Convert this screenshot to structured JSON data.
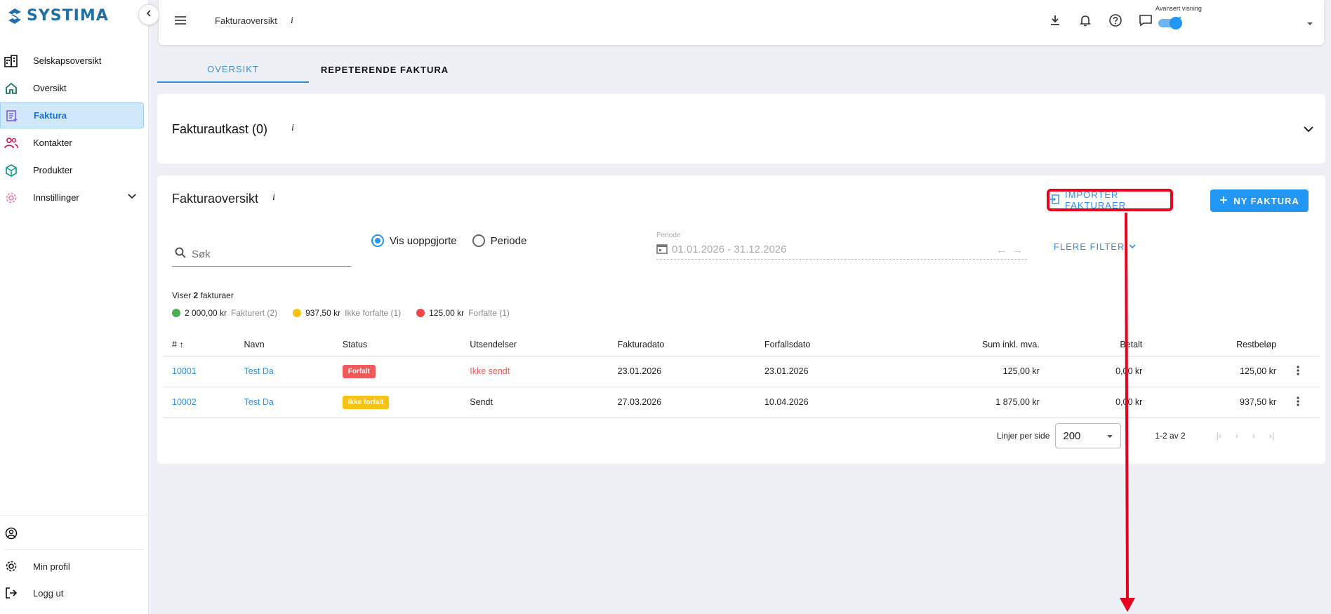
{
  "app": {
    "logo_text": "SYSTIMA"
  },
  "sidebar": {
    "items": [
      {
        "label": "Selskapsoversikt",
        "icon": "building-icon"
      },
      {
        "label": "Oversikt",
        "icon": "home-icon"
      },
      {
        "label": "Faktura",
        "icon": "invoice-icon",
        "active": true
      },
      {
        "label": "Kontakter",
        "icon": "people-icon"
      },
      {
        "label": "Produkter",
        "icon": "box-icon"
      },
      {
        "label": "Innstillinger",
        "icon": "gear-icon"
      }
    ],
    "bottom": [
      {
        "label": "",
        "icon": "user-circle-icon"
      },
      {
        "label": "Min profil",
        "icon": "gear-icon"
      },
      {
        "label": "Logg ut",
        "icon": "logout-icon"
      }
    ]
  },
  "header": {
    "title": "Fakturaoversikt",
    "info": "i",
    "advanced_label": "Avansert visning",
    "advanced_on": true
  },
  "tabs": [
    {
      "label": "OVERSIKT",
      "active": true
    },
    {
      "label": "REPETERENDE FAKTURA",
      "active": false
    }
  ],
  "drafts": {
    "title": "Fakturautkast (0)",
    "info": "i"
  },
  "overview": {
    "title": "Fakturaoversikt",
    "info": "i",
    "import_label": "IMPORTER FAKTURAER",
    "new_label": "NY FAKTURA",
    "search_placeholder": "Søk",
    "radio_unsettled": "Vis uoppgjorte",
    "radio_period": "Periode",
    "period_label": "Periode",
    "period_value": "01.01.2026 - 31.12.2026",
    "more_filters": "FLERE FILTER",
    "showing_prefix": "Viser",
    "showing_count": "2",
    "showing_suffix": "fakturaer",
    "legend": [
      {
        "amount": "2 000,00 kr",
        "label": "Fakturert (2)",
        "color": "#4caf50"
      },
      {
        "amount": "937,50 kr",
        "label": "Ikke forfalte (1)",
        "color": "#f7c214"
      },
      {
        "amount": "125,00 kr",
        "label": "Forfalte (1)",
        "color": "#f04848"
      }
    ],
    "columns": [
      "#",
      "Navn",
      "Status",
      "Utsendelser",
      "Fakturadato",
      "Forfallsdato",
      "Sum inkl. mva.",
      "Betalt",
      "Restbeløp"
    ],
    "rows": [
      {
        "id": "10001",
        "name": "Test Da",
        "status": "Forfalt",
        "sending": "Ikke sendt",
        "invoice_date": "23.01.2026",
        "due_date": "23.01.2026",
        "sum": "125,00 kr",
        "paid": "0,00 kr",
        "rest": "125,00 kr"
      },
      {
        "id": "10002",
        "name": "Test Da",
        "status": "Ikke forfalt",
        "sending": "Sendt",
        "invoice_date": "27.03.2026",
        "due_date": "10.04.2026",
        "sum": "1 875,00 kr",
        "paid": "0,00 kr",
        "rest": "937,50 kr"
      }
    ],
    "pager": {
      "per_page_label": "Linjer per side",
      "per_page": "200",
      "range": "1-2 av 2"
    }
  },
  "colors": {
    "accent": "#2196f3",
    "highlight": "#e8001c"
  }
}
